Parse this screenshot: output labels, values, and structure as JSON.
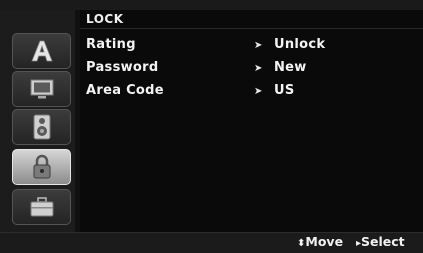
{
  "header": {
    "title": "LOCK"
  },
  "sidebar": {
    "tabs": [
      {
        "icon": "letter-a-icon",
        "active": false
      },
      {
        "icon": "monitor-icon",
        "active": false
      },
      {
        "icon": "speaker-icon",
        "active": false
      },
      {
        "icon": "padlock-icon",
        "active": true
      },
      {
        "icon": "briefcase-icon",
        "active": false
      }
    ]
  },
  "settings": [
    {
      "label": "Rating",
      "value": "Unlock"
    },
    {
      "label": "Password",
      "value": "New"
    },
    {
      "label": "Area Code",
      "value": "US"
    }
  ],
  "footer": {
    "move_label": "Move",
    "select_label": "Select",
    "move_icon": "up-down-arrows-icon",
    "select_icon": "right-triangle-icon"
  },
  "colors": {
    "background": "#0a0a0a",
    "sidebar": "#1c1c1c",
    "active_tab": "#c8c8c8",
    "text": "#f2f2f2"
  }
}
